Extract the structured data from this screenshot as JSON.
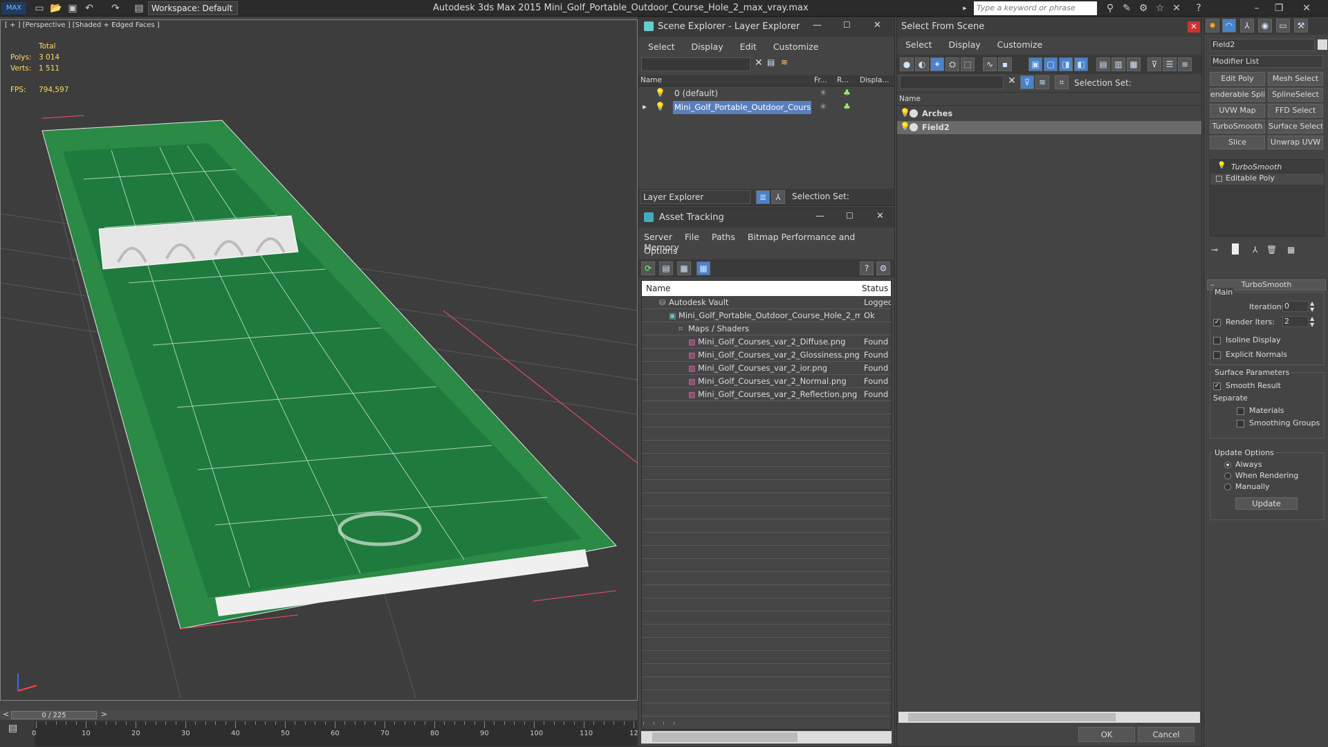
{
  "window": {
    "app_title": "Autodesk 3ds Max  2015      Mini_Golf_Portable_Outdoor_Course_Hole_2_max_vray.max",
    "workspace_label": "Workspace: Default",
    "search_placeholder": "Type a keyword or phrase"
  },
  "viewport": {
    "label": "[ + ] [Perspective ] [Shaded + Edged Faces ]",
    "stats_total_label": "Total",
    "polys_label": "Polys:",
    "polys_value": "3 014",
    "verts_label": "Verts:",
    "verts_value": "1 511",
    "fps_label": "FPS:",
    "fps_value": "794,597"
  },
  "scene_explorer": {
    "title": "Scene Explorer - Layer Explorer",
    "menu": [
      "Select",
      "Display",
      "Edit",
      "Customize"
    ],
    "columns": {
      "name": "Name",
      "frozen": "Fr...",
      "render": "R...",
      "display": "Displa..."
    },
    "rows": [
      {
        "name": "0 (default)",
        "selected": false
      },
      {
        "name": "Mini_Golf_Portable_Outdoor_Course_...",
        "selected": true
      }
    ],
    "footer_dropdown": "Layer Explorer",
    "footer_selection_set": "Selection Set:"
  },
  "asset_tracking": {
    "title": "Asset Tracking",
    "menu": [
      "Server",
      "File",
      "Paths",
      "Bitmap Performance and Memory"
    ],
    "menu2": "Options",
    "columns": {
      "name": "Name",
      "status": "Status"
    },
    "rows": [
      {
        "name": "Autodesk Vault",
        "status": "Logged",
        "indent": 0,
        "icon": "vault-icon"
      },
      {
        "name": "Mini_Golf_Portable_Outdoor_Course_Hole_2_m...",
        "status": "Ok",
        "indent": 1,
        "icon": "max-file-icon"
      },
      {
        "name": "Maps / Shaders",
        "status": "",
        "indent": 2,
        "icon": "maps-icon"
      },
      {
        "name": "Mini_Golf_Courses_var_2_Diffuse.png",
        "status": "Found",
        "indent": 3,
        "icon": "png-icon"
      },
      {
        "name": "Mini_Golf_Courses_var_2_Glossiness.png",
        "status": "Found",
        "indent": 3,
        "icon": "png-icon"
      },
      {
        "name": "Mini_Golf_Courses_var_2_ior.png",
        "status": "Found",
        "indent": 3,
        "icon": "png-icon"
      },
      {
        "name": "Mini_Golf_Courses_var_2_Normal.png",
        "status": "Found",
        "indent": 3,
        "icon": "png-icon"
      },
      {
        "name": "Mini_Golf_Courses_var_2_Reflection.png",
        "status": "Found",
        "indent": 3,
        "icon": "png-icon"
      }
    ]
  },
  "select_from_scene": {
    "title": "Select From Scene",
    "menu": [
      "Select",
      "Display",
      "Customize"
    ],
    "selection_set_label": "Selection Set:",
    "column_name": "Name",
    "rows": [
      {
        "name": "Arches",
        "selected": false
      },
      {
        "name": "Field2",
        "selected": true
      }
    ],
    "ok_label": "OK",
    "cancel_label": "Cancel"
  },
  "command_panel": {
    "object_name": "Field2",
    "modifier_list": "Modifier List",
    "modifier_buttons": [
      "Edit Poly",
      "Mesh Select",
      "enderable Splir",
      "SplineSelect",
      "UVW Map",
      "FFD Select",
      "TurboSmooth",
      "Surface Select",
      "Slice",
      "Unwrap UVW"
    ],
    "stack": [
      "TurboSmooth",
      "Editable Poly"
    ],
    "rollout_title": "TurboSmooth",
    "main_label": "Main",
    "iterations_label": "Iterations:",
    "iterations_value": "0",
    "render_iters_label": "Render Iters:",
    "render_iters_value": "2",
    "render_iters_checked": true,
    "isoline_label": "Isoline Display",
    "explicit_normals_label": "Explicit Normals",
    "surface_params_label": "Surface Parameters",
    "smooth_result_label": "Smooth Result",
    "separate_label": "Separate",
    "materials_label": "Materials",
    "smoothing_groups_label": "Smoothing Groups",
    "update_options_label": "Update Options",
    "always_label": "Always",
    "when_rendering_label": "When Rendering",
    "manually_label": "Manually",
    "update_button": "Update"
  },
  "timeline": {
    "frame_counter": "0 / 225",
    "ticks": [
      "0",
      "10",
      "20",
      "30",
      "40",
      "50",
      "60",
      "70",
      "80",
      "90",
      "100",
      "110",
      "12"
    ]
  },
  "colors": {
    "accent": "#5a7fbd",
    "grass": "#1f7a3e",
    "stat_yellow": "#ffde5a"
  }
}
